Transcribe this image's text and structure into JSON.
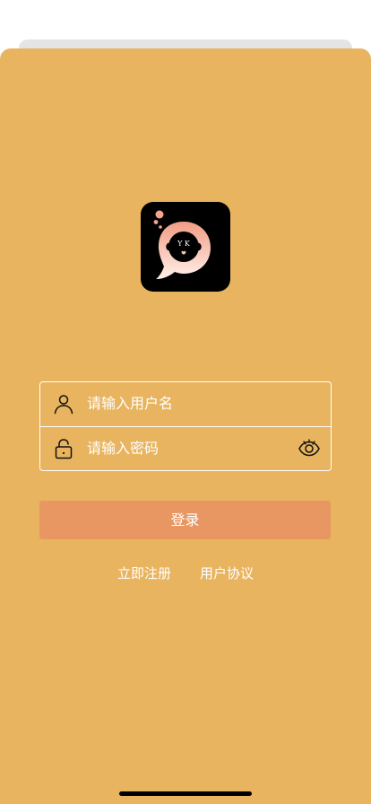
{
  "logo": {
    "letters": "Y K"
  },
  "login_form": {
    "username": {
      "placeholder": "请输入用户名",
      "icon": "user-icon"
    },
    "password": {
      "placeholder": "请输入密码",
      "icon": "lock-icon",
      "toggle_icon": "eye-icon"
    }
  },
  "actions": {
    "login_label": "登录",
    "register_label": "立即注册",
    "agreement_label": "用户协议"
  },
  "colors": {
    "background": "#e8b45f",
    "button": "#e89762",
    "logo_background": "#000000"
  }
}
